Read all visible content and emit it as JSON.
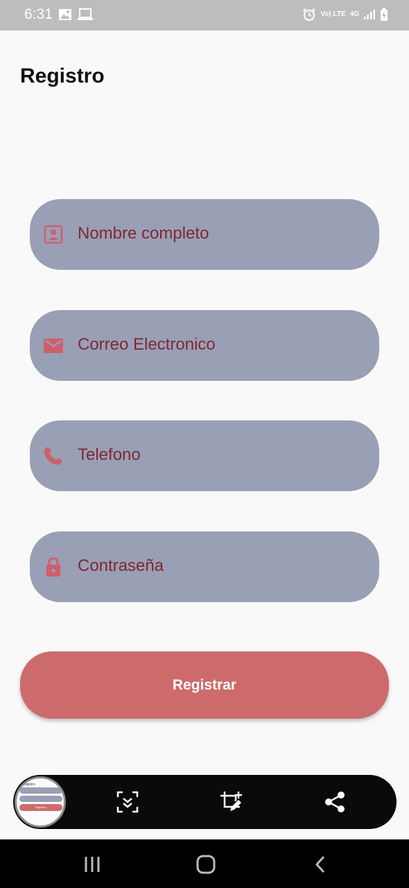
{
  "status_bar": {
    "time": "6:31",
    "left_icons": [
      "image-icon",
      "laptop-icon"
    ],
    "right_icons": [
      "alarm-icon",
      "volte-icon",
      "4g-icon",
      "signal-icon",
      "battery-charging-icon"
    ],
    "volte_text": "Vo) LTE",
    "network_text": "4G"
  },
  "page": {
    "title": "Registro"
  },
  "form": {
    "fields": [
      {
        "label": "Nombre completo",
        "icon": "contact-card-icon"
      },
      {
        "label": "Correo Electronico",
        "icon": "mail-icon"
      },
      {
        "label": "Telefono",
        "icon": "phone-icon"
      },
      {
        "label": "Contraseña",
        "icon": "lock-icon"
      }
    ],
    "submit_label": "Registrar"
  },
  "colors": {
    "field_bg": "#999fb5",
    "field_text": "#7f2831",
    "icon_color": "#cf5f6a",
    "button_bg": "#cd6b6c"
  },
  "screenshot_toolbar": {
    "thumbnail_title": "Registro",
    "thumbnail_button": "Registrar",
    "tools": [
      "scroll-capture-icon",
      "crop-edit-icon",
      "share-icon"
    ]
  },
  "nav_bar": {
    "buttons": [
      "recent-apps-icon",
      "home-icon",
      "back-icon"
    ]
  }
}
